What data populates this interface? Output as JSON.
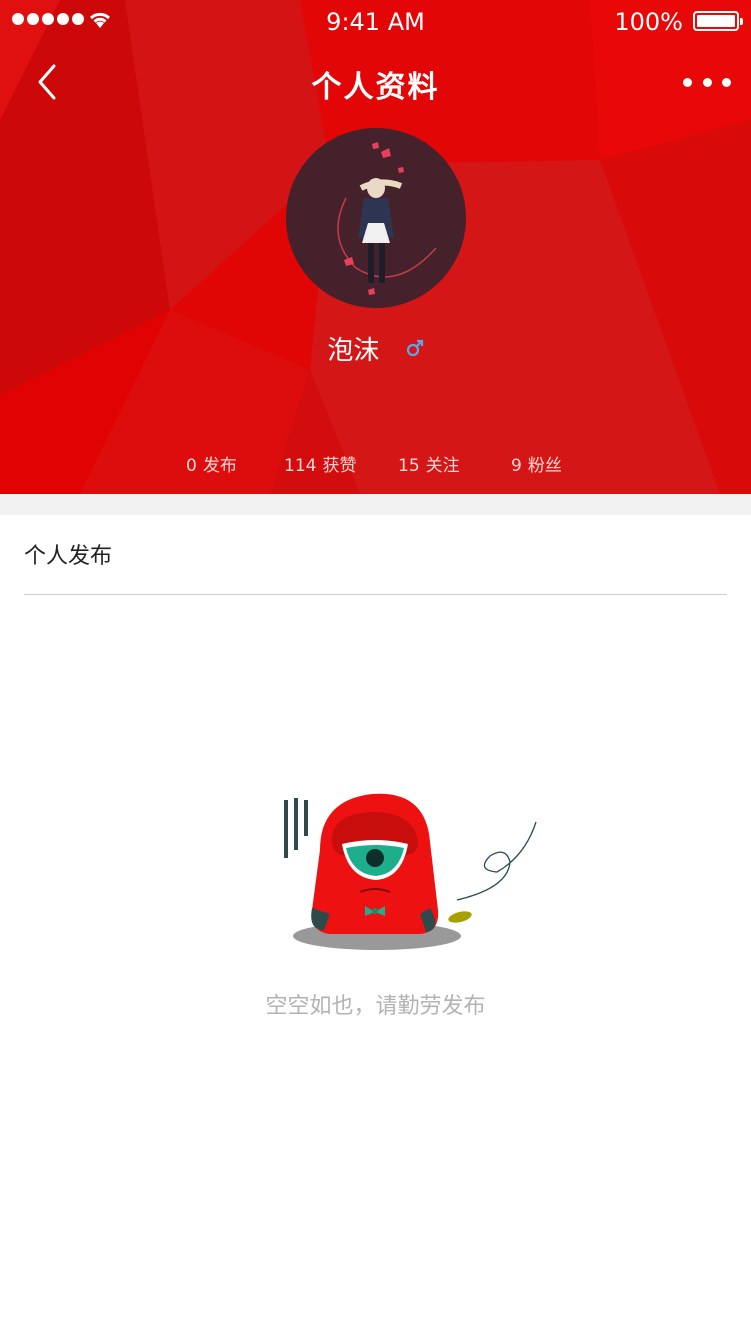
{
  "status_bar": {
    "time": "9:41 AM",
    "battery": "100%"
  },
  "nav": {
    "title": "个人资料",
    "back_icon": "chevron-left-icon",
    "more_icon": "more-dots-icon"
  },
  "profile": {
    "username": "泡沫",
    "gender_symbol": "♂",
    "gender_color": "#5aa7e8"
  },
  "stats": [
    {
      "num": "0",
      "label": "发布"
    },
    {
      "num": "114",
      "label": "获赞"
    },
    {
      "num": "15",
      "label": "关注"
    },
    {
      "num": "9",
      "label": "粉丝"
    }
  ],
  "section": {
    "title": "个人发布"
  },
  "empty_state": {
    "message": "空空如也，请勤劳发布"
  },
  "colors": {
    "header_red": "#dd0a0a",
    "divider": "#cfcfcf",
    "placeholder_gray": "#b3b3b3"
  }
}
